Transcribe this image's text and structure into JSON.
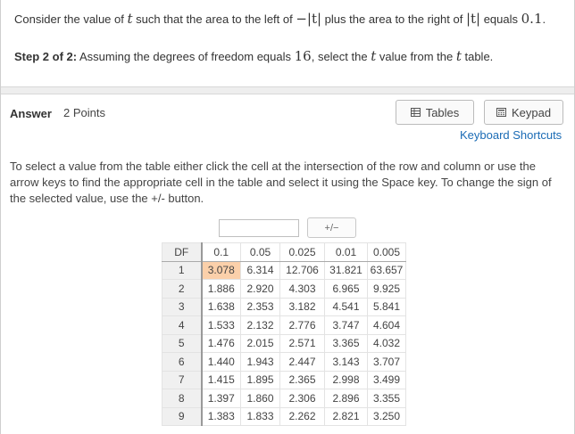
{
  "question": {
    "prefix": "Consider the value of ",
    "t_var": "t",
    "middle": " such that the area to the left of ",
    "neg_abs_t": "−|t|",
    "middle2": " plus the area to the right of ",
    "abs_t": "|t|",
    "middle3": " equals ",
    "value": "0.1",
    "suffix": "."
  },
  "step": {
    "label": "Step 2 of 2:",
    "prefix": " Assuming the degrees of freedom equals ",
    "df": "16",
    "middle": ", select the ",
    "t_var": "t",
    "middle2": " value from the ",
    "t_var2": "t",
    "suffix": " table."
  },
  "answer": {
    "label": "Answer",
    "points": "2 Points",
    "tables_label": "Tables",
    "keypad_label": "Keypad",
    "shortcuts_label": "Keyboard Shortcuts"
  },
  "instructions": "To select a value from the table either click the cell at the intersection of the row and column or use the arrow keys to find the appropriate cell in the table and select it using the Space key. To change the sign of the selected value, use the +/- button.",
  "input": {
    "value": ""
  },
  "sign_button_label": "+/−",
  "t_table": {
    "headers": [
      "DF",
      "0.1",
      "0.05",
      "0.025",
      "0.01",
      "0.005"
    ],
    "rows": [
      [
        "1",
        "3.078",
        "6.314",
        "12.706",
        "31.821",
        "63.657"
      ],
      [
        "2",
        "1.886",
        "2.920",
        "4.303",
        "6.965",
        "9.925"
      ],
      [
        "3",
        "1.638",
        "2.353",
        "3.182",
        "4.541",
        "5.841"
      ],
      [
        "4",
        "1.533",
        "2.132",
        "2.776",
        "3.747",
        "4.604"
      ],
      [
        "5",
        "1.476",
        "2.015",
        "2.571",
        "3.365",
        "4.032"
      ],
      [
        "6",
        "1.440",
        "1.943",
        "2.447",
        "3.143",
        "3.707"
      ],
      [
        "7",
        "1.415",
        "1.895",
        "2.365",
        "2.998",
        "3.499"
      ],
      [
        "8",
        "1.397",
        "1.860",
        "2.306",
        "2.896",
        "3.355"
      ],
      [
        "9",
        "1.383",
        "1.833",
        "2.262",
        "2.821",
        "3.250"
      ]
    ],
    "highlight_color": "#fbd0aa",
    "highlighted_cell": {
      "row": 0,
      "col": 1
    }
  },
  "colors": {
    "link": "#1a6bb5",
    "df_column_bg": "#f0f0f0"
  },
  "icons": {
    "tables": "table-grid-icon",
    "keypad": "calculator-icon"
  }
}
